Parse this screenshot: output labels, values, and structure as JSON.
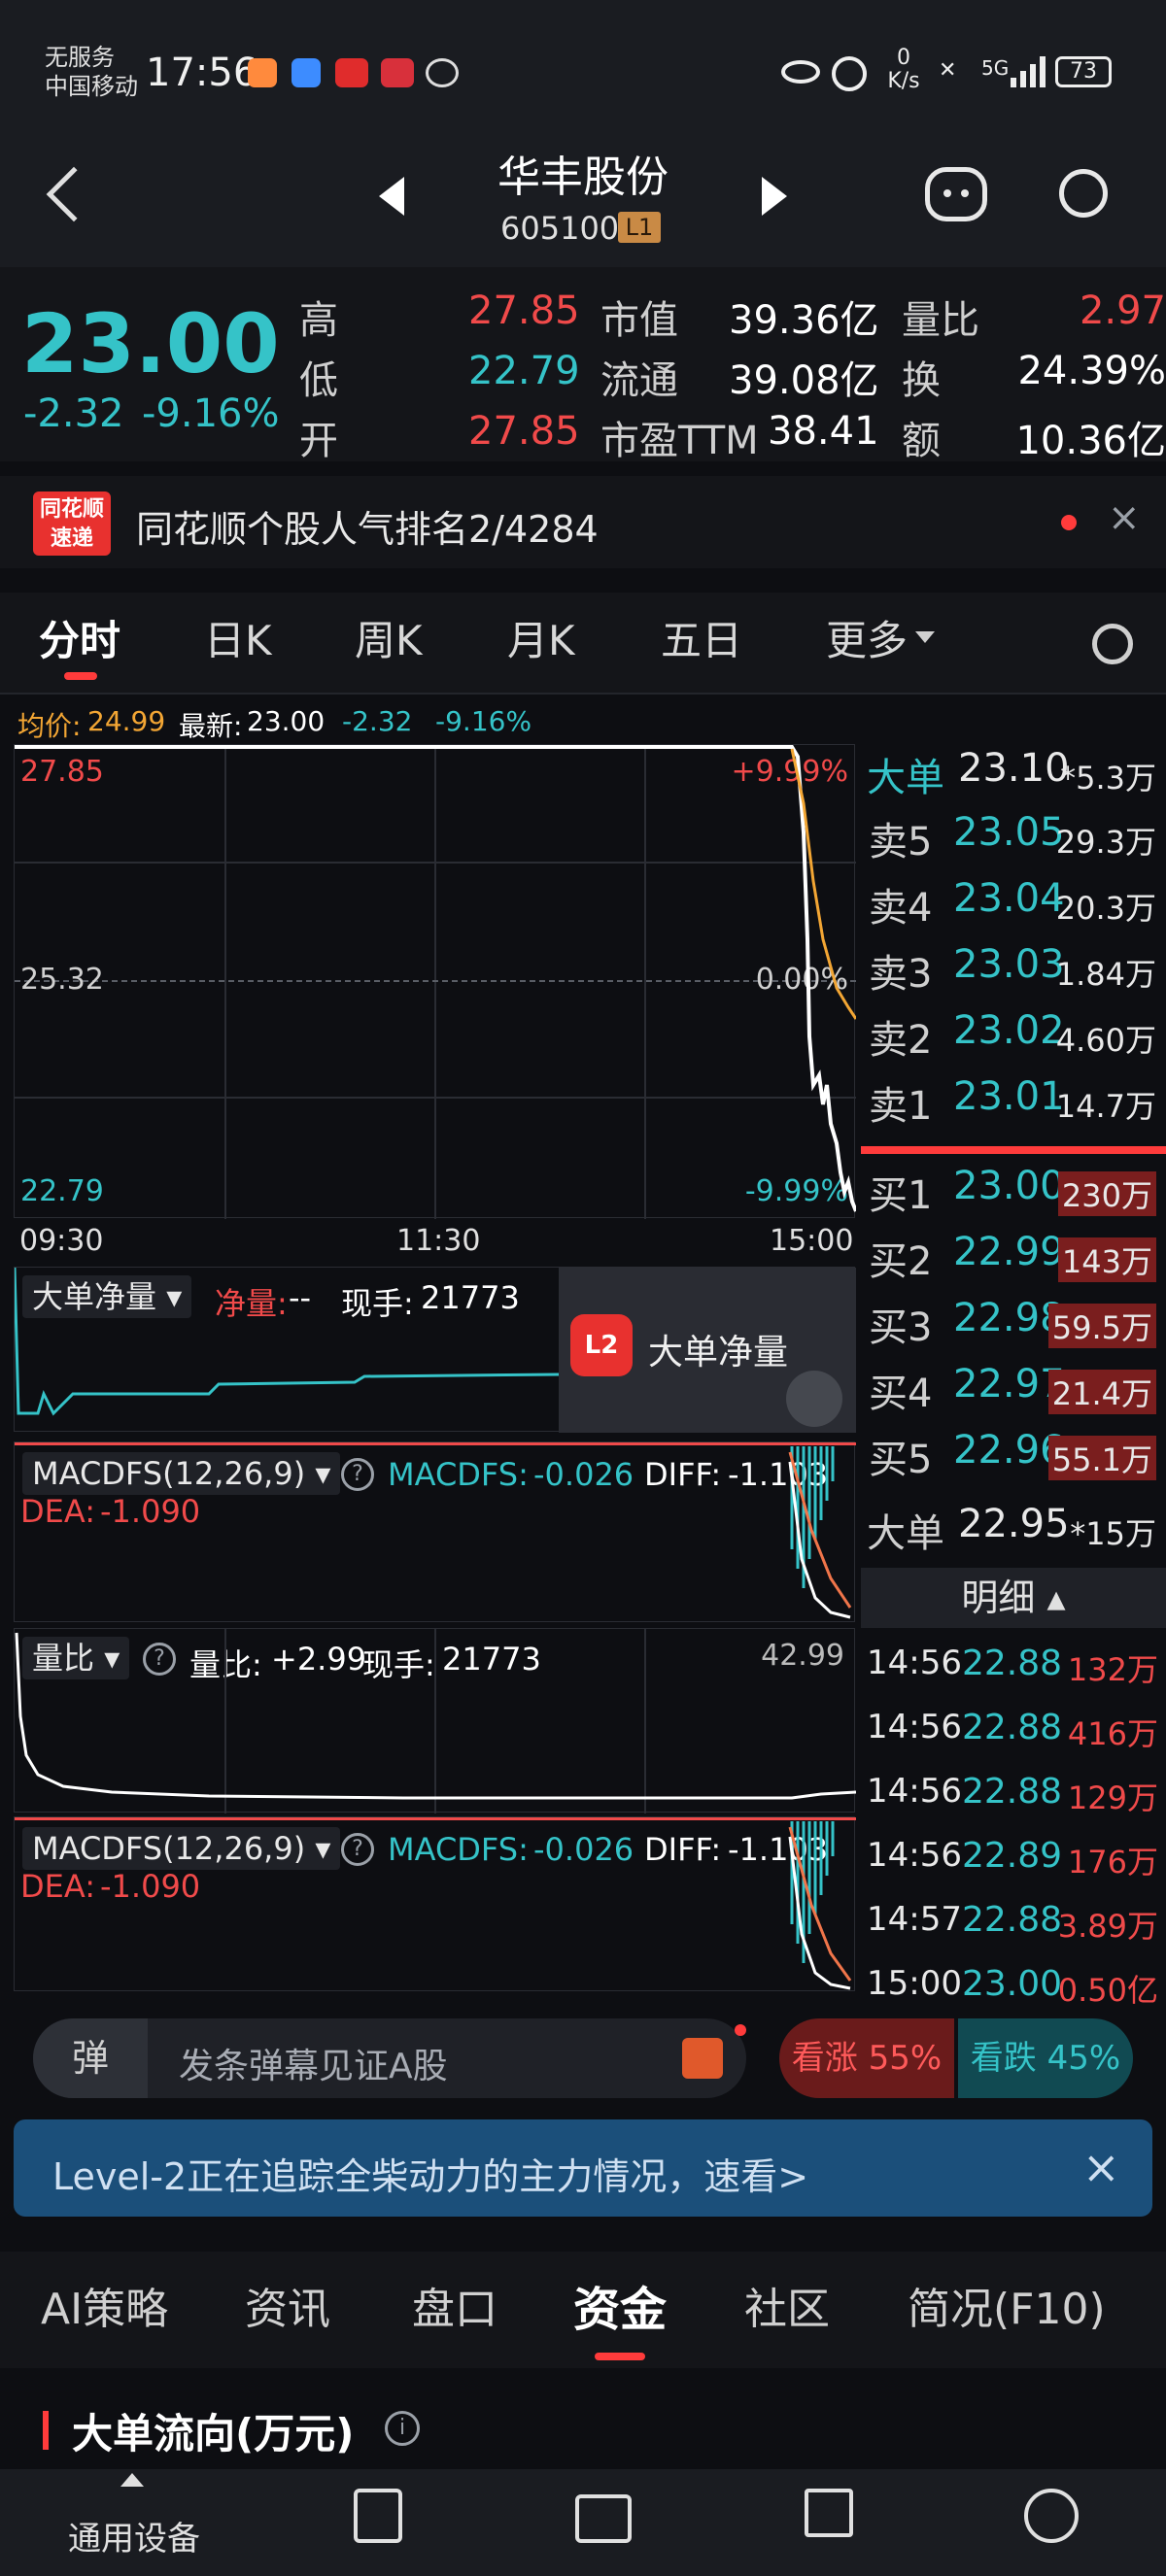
{
  "status": {
    "carrier_line1": "无服务",
    "carrier_line2": "中国移动",
    "time": "17:56",
    "speed_value": "0",
    "speed_unit": "K/s",
    "battery": "73"
  },
  "header": {
    "name": "华丰股份",
    "code": "605100",
    "level_badge": "L1"
  },
  "quote": {
    "price": "23.00",
    "change": "-2.32",
    "change_pct": "-9.16%",
    "high_label": "高",
    "high": "27.85",
    "low_label": "低",
    "low": "22.79",
    "open_label": "开",
    "open": "27.85",
    "mktcap_label": "市值",
    "mktcap": "39.36亿",
    "float_label": "流通",
    "float": "39.08亿",
    "pe_label": "市盈TTM",
    "pe": "38.41",
    "vr_label": "量比",
    "vr": "2.97",
    "turnover_label": "换",
    "turnover": "24.39%",
    "amount_label": "额",
    "amount": "10.36亿"
  },
  "promo": {
    "logo_line1": "同花顺",
    "logo_line2": "速递",
    "text": "同花顺个股人气排名2/4284"
  },
  "tabs": [
    "分时",
    "日K",
    "周K",
    "月K",
    "五日",
    "更多"
  ],
  "intraday": {
    "avg_label": "均价:",
    "avg": "24.99",
    "latest_label": "最新:",
    "latest": "23.00",
    "chg": "-2.32",
    "chg_pct": "-9.16%",
    "y_top": "27.85",
    "y_mid": "25.32",
    "y_bot": "22.79",
    "pct_top": "+9.99%",
    "pct_mid": "0.00%",
    "pct_bot": "-9.99%",
    "x_labels": [
      "09:30",
      "11:30",
      "15:00"
    ]
  },
  "big_order": {
    "selector": "大单净量",
    "net_label": "净量:",
    "net": "--",
    "hand_label": "现手:",
    "hand": "21773",
    "overlay_text": "大单净量"
  },
  "macd1": {
    "selector": "MACDFS(12,26,9)",
    "macd_label": "MACDFS:",
    "macd": "-0.026",
    "diff_label": "DIFF:",
    "diff": "-1.103",
    "dea_label": "DEA:",
    "dea": "-1.090"
  },
  "volratio": {
    "selector": "量比",
    "vr_label": "量比:",
    "vr": "+2.99",
    "hand_label": "现手:",
    "hand": "21773",
    "max": "42.99"
  },
  "macd2": {
    "selector": "MACDFS(12,26,9)",
    "macd_label": "MACDFS:",
    "macd": "-0.026",
    "diff_label": "DIFF:",
    "diff": "-1.103",
    "dea_label": "DEA:",
    "dea": "-1.090"
  },
  "orderbook": {
    "big_sell": {
      "label": "大单",
      "price": "23.10",
      "vol": "*5.3万"
    },
    "asks": [
      {
        "label": "卖5",
        "price": "23.05",
        "vol": "29.3万"
      },
      {
        "label": "卖4",
        "price": "23.04",
        "vol": "20.3万"
      },
      {
        "label": "卖3",
        "price": "23.03",
        "vol": "1.84万"
      },
      {
        "label": "卖2",
        "price": "23.02",
        "vol": "4.60万"
      },
      {
        "label": "卖1",
        "price": "23.01",
        "vol": "14.7万"
      }
    ],
    "bids": [
      {
        "label": "买1",
        "price": "23.00",
        "vol": "230万"
      },
      {
        "label": "买2",
        "price": "22.99",
        "vol": "143万"
      },
      {
        "label": "买3",
        "price": "22.98",
        "vol": "59.5万"
      },
      {
        "label": "买4",
        "price": "22.97",
        "vol": "21.4万"
      },
      {
        "label": "买5",
        "price": "22.96",
        "vol": "55.1万"
      }
    ],
    "big_buy": {
      "label": "大单",
      "price": "22.95",
      "vol": "*15万"
    },
    "detail_label": "明细",
    "ticks": [
      {
        "time": "14:56",
        "price": "22.88",
        "vol": "132万"
      },
      {
        "time": "14:56",
        "price": "22.88",
        "vol": "416万"
      },
      {
        "time": "14:56",
        "price": "22.88",
        "vol": "129万"
      },
      {
        "time": "14:56",
        "price": "22.89",
        "vol": "176万"
      },
      {
        "time": "14:57",
        "price": "22.88",
        "vol": "3.89万"
      },
      {
        "time": "15:00",
        "price": "23.00",
        "vol": "0.50亿"
      }
    ]
  },
  "danmu": {
    "icon_text": "弹",
    "placeholder": "发条弹幕见证A股",
    "up_label": "看涨 55%",
    "down_label": "看跌 45%"
  },
  "banner": {
    "text": "Level-2正在追踪全柴动力的主力情况，速看>"
  },
  "bottom_tabs": [
    "AI策略",
    "资讯",
    "盘口",
    "资金",
    "社区",
    "简况(F10)"
  ],
  "section": {
    "title": "大单流向(万元)"
  },
  "navbar": {
    "item1": "通用设备"
  }
}
